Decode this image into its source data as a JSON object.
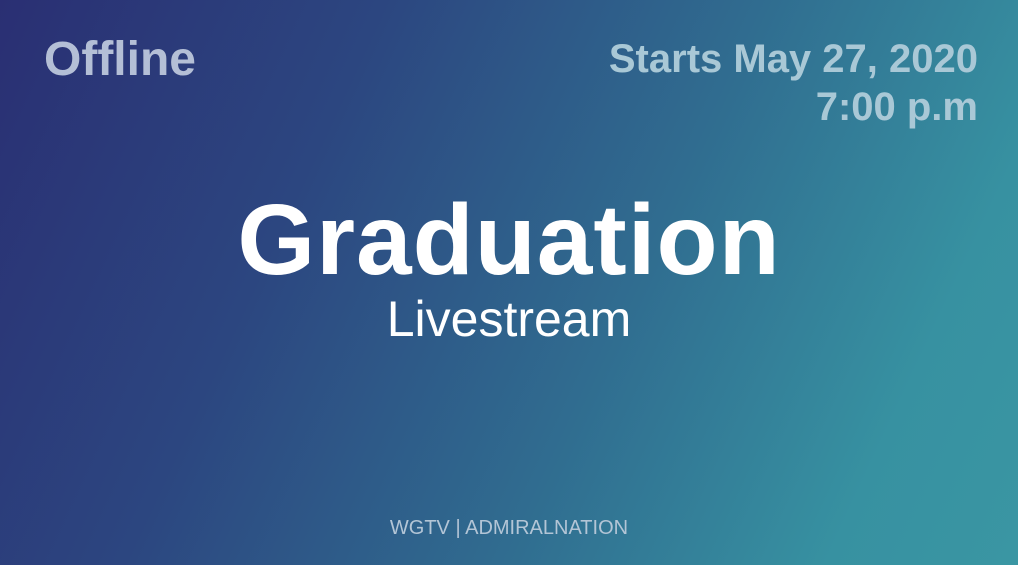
{
  "status": {
    "label": "Offline"
  },
  "schedule": {
    "date_line": "Starts May 27, 2020",
    "time_line": "7:00 p.m"
  },
  "event": {
    "title": "Graduation",
    "subtitle": "Livestream"
  },
  "footer": {
    "text": "WGTV | ADMIRALNATION"
  },
  "colors": {
    "gradient_start": "#2a2f73",
    "gradient_end": "#3a96a3",
    "status_text": "#b4bfd6",
    "schedule_text": "#a9c8d6",
    "title_text": "#ffffff",
    "footer_text": "#b3c5d6"
  }
}
